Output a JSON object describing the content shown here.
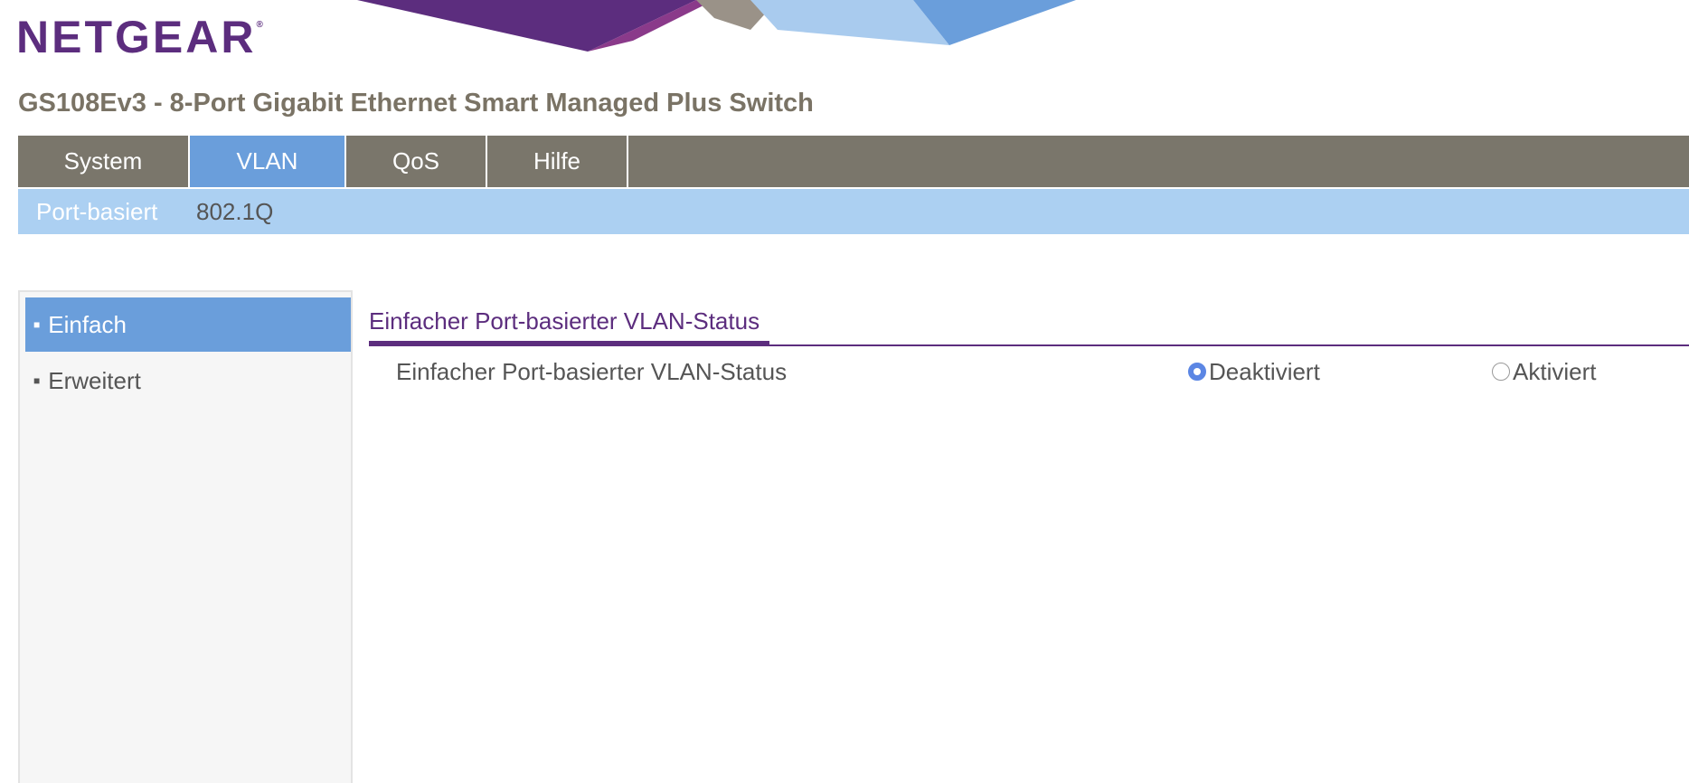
{
  "brand": {
    "logo_text": "NETGEAR",
    "registered_mark": "®",
    "product_title": "GS108Ev3 - 8-Port Gigabit Ethernet Smart Managed Plus Switch"
  },
  "colors": {
    "brand_purple": "#5c2d7e",
    "nav_gray": "#7a766b",
    "active_blue": "#6a9edb",
    "subnav_blue": "#acd0f2",
    "radio_blue": "#5b86e4"
  },
  "topnav": {
    "tabs": [
      {
        "label": "System",
        "active": false
      },
      {
        "label": "VLAN",
        "active": true
      },
      {
        "label": "QoS",
        "active": false
      },
      {
        "label": "Hilfe",
        "active": false
      }
    ]
  },
  "subnav": {
    "tabs": [
      {
        "label": "Port-basiert",
        "active": true
      },
      {
        "label": "802.1Q",
        "active": false
      }
    ]
  },
  "sidebar": {
    "items": [
      {
        "label": "Einfach",
        "active": true
      },
      {
        "label": "Erweitert",
        "active": false
      }
    ]
  },
  "main": {
    "section_heading": "Einfacher Port-basierter VLAN-Status",
    "field_label": "Einfacher Port-basierter VLAN-Status",
    "options": [
      {
        "label": "Deaktiviert",
        "selected": true
      },
      {
        "label": "Aktiviert",
        "selected": false
      }
    ]
  }
}
